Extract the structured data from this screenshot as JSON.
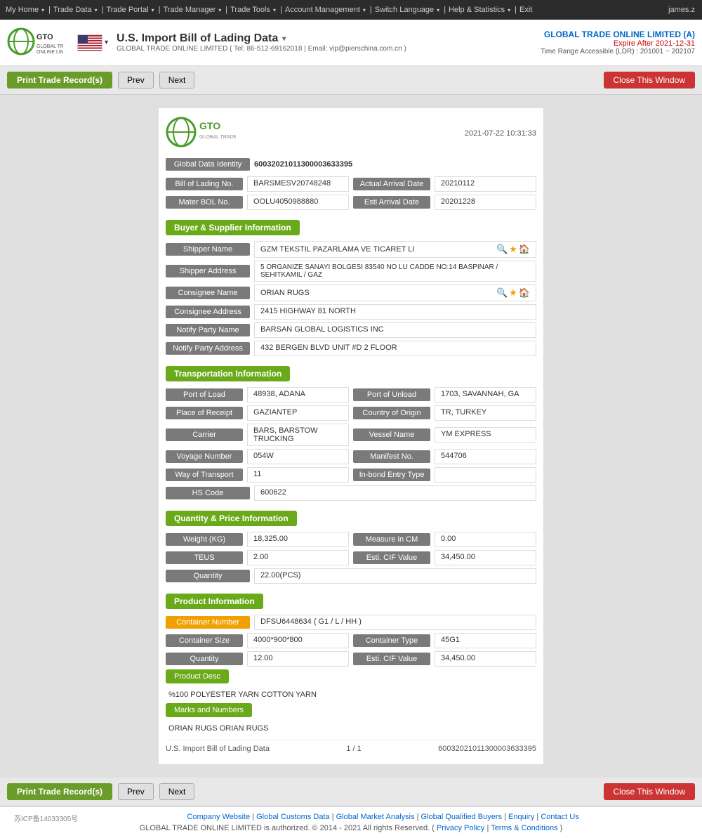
{
  "topNav": {
    "items": [
      "My Home",
      "Trade Data",
      "Trade Portal",
      "Trade Manager",
      "Trade Tools",
      "Account Management",
      "Switch Language",
      "Help & Statistics",
      "Exit"
    ],
    "user": "james.z"
  },
  "header": {
    "title": "U.S. Import Bill of Lading Data",
    "company": "GLOBAL TRADE ONLINE LIMITED",
    "contact": "Tel: 86-512-69162018 | Email: vip@pierschina.com.cn",
    "companyFull": "GLOBAL TRADE ONLINE LIMITED (A)",
    "expire": "Expire After 2021-12-31",
    "timeRange": "Time Range Accessible (LDR) : 201001 ~ 202107"
  },
  "toolbar": {
    "printLabel": "Print Trade Record(s)",
    "prevLabel": "Prev",
    "nextLabel": "Next",
    "closeLabel": "Close This Window"
  },
  "record": {
    "datetime": "2021-07-22 10:31:33",
    "globalDataIdentity": "60032021011300003633395",
    "billOfLadingNo": "BARSMESV20748248",
    "actualArrivalDate": "20210112",
    "materBOLNo": "OOLU4050988880",
    "estiArrivalDate": "20201228",
    "buyerSupplierSection": "Buyer & Supplier Information",
    "shipperName": "GZM TEKSTIL PAZARLAMA VE TICARET LI",
    "shipperAddress": "5 ORGANIZE SANAYI BOLGESI 83540 NO LU CADDE NO:14 BASPINAR / SEHITKAMIL / GAZ",
    "consigneeName": "ORIAN RUGS",
    "consigneeAddress": "2415 HIGHWAY 81 NORTH",
    "notifyPartyName": "BARSAN GLOBAL LOGISTICS INC",
    "notifyPartyAddress": "432 BERGEN BLVD UNIT #D 2 FLOOR",
    "transportationSection": "Transportation Information",
    "portOfLoad": "48938, ADANA",
    "portOfUnload": "1703, SAVANNAH, GA",
    "placeOfReceipt": "GAZIANTEP",
    "countryOfOrigin": "TR, TURKEY",
    "carrier": "BARS, BARSTOW TRUCKING",
    "vesselName": "YM EXPRESS",
    "voyageNumber": "054W",
    "manifestNo": "544706",
    "wayOfTransport": "11",
    "inBondEntryType": "",
    "hsCode": "600622",
    "quantityPriceSection": "Quantity & Price Information",
    "weightKG": "18,325.00",
    "measureInCM": "0.00",
    "teus": "2.00",
    "estiCIFValue1": "34,450.00",
    "quantity": "22.00(PCS)",
    "productSection": "Product Information",
    "containerNumber": "DFSU6448634 ( G1 / L / HH )",
    "containerSize": "4000*900*800",
    "containerType": "45G1",
    "quantityProduct": "12.00",
    "estiCIFValue2": "34,450.00",
    "productDescLabel": "Product Desc",
    "productDescText": "%100 POLYESTER YARN COTTON YARN",
    "marksLabel": "Marks and Numbers",
    "marksText": "ORIAN RUGS ORIAN RUGS",
    "footerLeft": "U.S. Import Bill of Lading Data",
    "footerCenter": "1 / 1",
    "footerRight": "60032021011300003633395"
  },
  "bottomNav": {
    "companyWebsite": "Company Website",
    "globalCustomsData": "Global Customs Data",
    "globalMarketAnalysis": "Global Market Analysis",
    "globalQualifiedBuyers": "Global Qualified Buyers",
    "enquiry": "Enquiry",
    "contactUs": "Contact Us",
    "copyright": "GLOBAL TRADE ONLINE LIMITED is authorized. © 2014 - 2021 All rights Reserved.",
    "privacyPolicy": "Privacy Policy",
    "termsConditions": "Terms & Conditions",
    "icp": "苏ICP备14033305号"
  }
}
